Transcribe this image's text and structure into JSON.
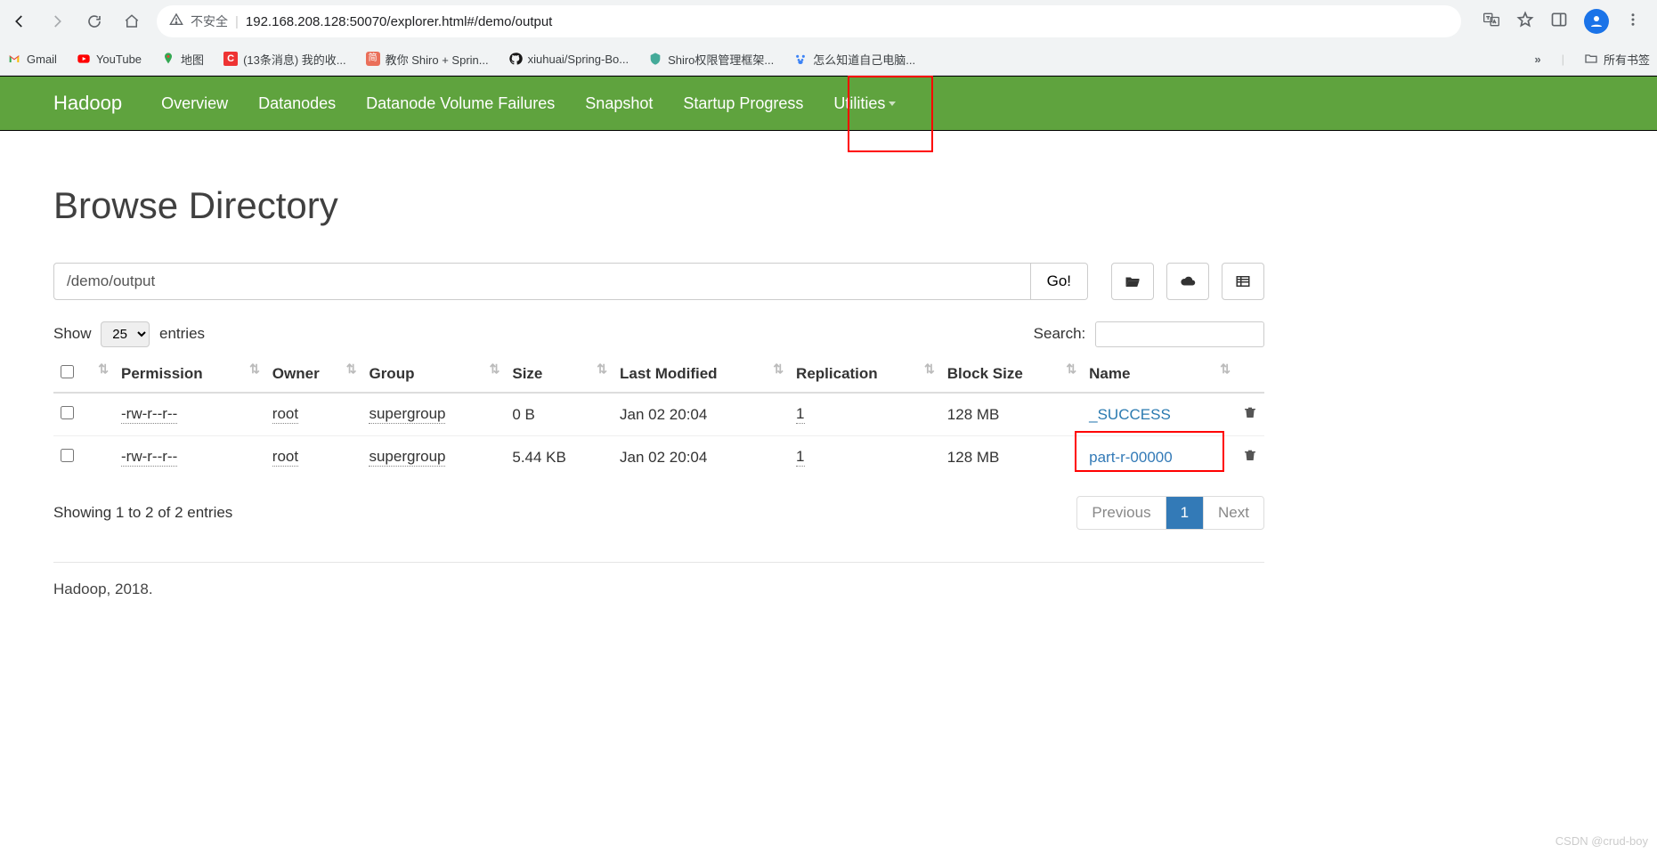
{
  "browser": {
    "insecure_label": "不安全",
    "url": "192.168.208.128:50070/explorer.html#/demo/output",
    "bookmarks": [
      {
        "label": "Gmail",
        "icon": "gmail"
      },
      {
        "label": "YouTube",
        "icon": "youtube"
      },
      {
        "label": "地图",
        "icon": "maps"
      },
      {
        "label": "(13条消息) 我的收...",
        "icon": "csdn"
      },
      {
        "label": "教你 Shiro + Sprin...",
        "icon": "jianshu"
      },
      {
        "label": "xiuhuai/Spring-Bo...",
        "icon": "github"
      },
      {
        "label": "Shiro权限管理框架...",
        "icon": "generic"
      },
      {
        "label": "怎么知道自己电脑...",
        "icon": "paw"
      }
    ],
    "all_bookmarks_label": "所有书签"
  },
  "nav": {
    "brand": "Hadoop",
    "items": [
      "Overview",
      "Datanodes",
      "Datanode Volume Failures",
      "Snapshot",
      "Startup Progress",
      "Utilities"
    ]
  },
  "page": {
    "title": "Browse Directory",
    "path_value": "/demo/output",
    "go_label": "Go!",
    "show_label_pre": "Show",
    "show_value": "25",
    "show_label_post": "entries",
    "search_label": "Search:",
    "columns": [
      "Permission",
      "Owner",
      "Group",
      "Size",
      "Last Modified",
      "Replication",
      "Block Size",
      "Name"
    ],
    "rows": [
      {
        "permission": "-rw-r--r--",
        "owner": "root",
        "group": "supergroup",
        "size": "0 B",
        "modified": "Jan 02 20:04",
        "replication": "1",
        "blocksize": "128 MB",
        "name": "_SUCCESS"
      },
      {
        "permission": "-rw-r--r--",
        "owner": "root",
        "group": "supergroup",
        "size": "5.44 KB",
        "modified": "Jan 02 20:04",
        "replication": "1",
        "blocksize": "128 MB",
        "name": "part-r-00000"
      }
    ],
    "info_text": "Showing 1 to 2 of 2 entries",
    "prev_label": "Previous",
    "page_num": "1",
    "next_label": "Next",
    "footer": "Hadoop, 2018."
  },
  "watermark": "CSDN @crud-boy"
}
